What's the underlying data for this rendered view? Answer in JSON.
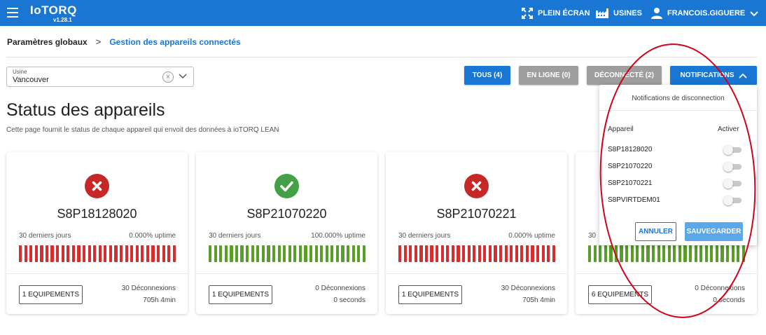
{
  "topbar": {
    "brand": "IoTORQ",
    "version": "v1.28.1",
    "fullscreen_label": "PLEIN ÉCRAN",
    "factories_label": "USINES",
    "user_label": "FRANCOIS.GIGUERE"
  },
  "breadcrumb": {
    "root": "Paramètres globaux",
    "separator": ">",
    "current": "Gestion des appareils connectés"
  },
  "usine": {
    "label": "Usine",
    "value": "Vancouver"
  },
  "filters": {
    "all": "TOUS (4)",
    "online": "EN LIGNE (0)",
    "offline": "DÉCONNECTÉ (2)",
    "notifications": "NOTIFICATIONS"
  },
  "page": {
    "title": "Status des appareils",
    "description": "Cette page fournit le status de chaque appareil qui envoit des données à ioTORQ LEAN"
  },
  "devices": [
    {
      "name": "S8P18128020",
      "status": "offline",
      "period": "30 derniers jours",
      "uptime": "0.000% uptime",
      "equipments": "1 EQUIPEMENTS",
      "disconnections": "30 Déconnexions",
      "duration": "705h 4min",
      "bar_color": "#d32f2f"
    },
    {
      "name": "S8P21070220",
      "status": "online",
      "period": "30 derniers jours",
      "uptime": "100.000% uptime",
      "equipments": "1 EQUIPEMENTS",
      "disconnections": "0 Déconnexions",
      "duration": "0 seconds",
      "bar_color": "#5a9e2a"
    },
    {
      "name": "S8P21070221",
      "status": "offline",
      "period": "30 derniers jours",
      "uptime": "0.000% uptime",
      "equipments": "1 EQUIPEMENTS",
      "disconnections": "30 Déconnexions",
      "duration": "705h 4min",
      "bar_color": "#d32f2f"
    },
    {
      "name": "",
      "status": "online",
      "period": "30",
      "uptime": "",
      "equipments": "6 EQUIPEMENTS",
      "disconnections": "0 Déconnexions",
      "duration": "0 seconds",
      "bar_color": "#5a9e2a"
    }
  ],
  "notifications_panel": {
    "title": "Notifications de disconnection",
    "col_device": "Appareil",
    "col_enable": "Activer",
    "rows": [
      {
        "device": "S8P18128020",
        "enabled": false
      },
      {
        "device": "S8P21070220",
        "enabled": false
      },
      {
        "device": "S8P21070221",
        "enabled": false
      },
      {
        "device": "S8PVIRTDEM01",
        "enabled": false
      }
    ],
    "cancel_label": "ANNULER",
    "save_label": "SAUVEGARDER"
  },
  "colors": {
    "primary": "#1976d2",
    "offline": "#c62828",
    "online": "#43a047",
    "filter_inactive": "#9e9e9e",
    "annotation": "#d0021b"
  }
}
